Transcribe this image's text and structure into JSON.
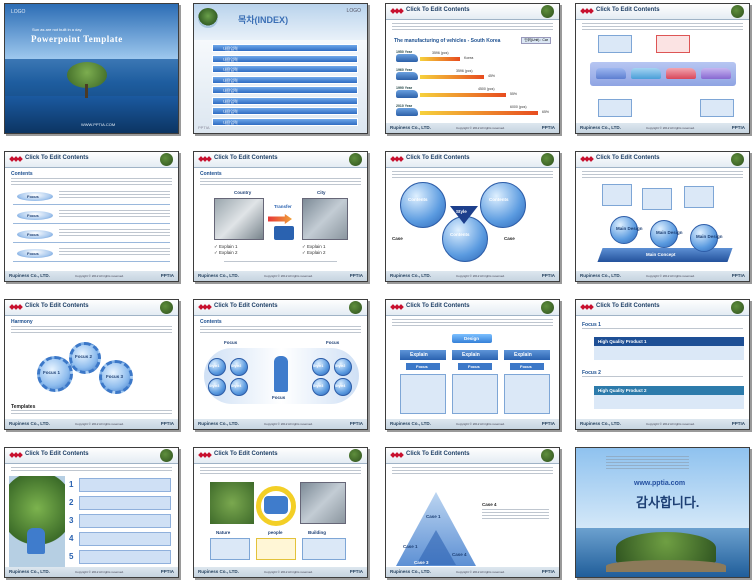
{
  "common": {
    "header_title": "Click To Edit Contents",
    "company": "Rupiness Co., LTD.",
    "copyright": "Copyright © 2012 All rights reserved.",
    "footer_brand": "PPTIA",
    "contents": "Contents"
  },
  "s1": {
    "logo": "LOGO",
    "tagline": "Sun as are not built in a day",
    "title": "Powerpoint Template",
    "url": "WWW.PPTIA.COM"
  },
  "s2": {
    "title": "목차(INDEX)",
    "logo": "LOGO",
    "items": [
      "내용입력",
      "내용입력",
      "내용입력",
      "내용입력",
      "내용입력",
      "내용입력",
      "내용입력",
      "내용입력"
    ]
  },
  "s3": {
    "chart_title": "The manufacturing of vehicles - South Korea",
    "badge": "단위(Unit) : Car",
    "rows": [
      {
        "year": "1950 Year",
        "value": "3596 (pcs)",
        "pct": "Korea"
      },
      {
        "year": "1960 Year",
        "value": "3596 (pcs)",
        "pct": "45%"
      },
      {
        "year": "1990 Year",
        "value": "4500 (pcs)",
        "pct": "55%"
      },
      {
        "year": "2010 Year",
        "value": "6000 (pcs)",
        "pct": "65%"
      }
    ]
  },
  "s5": {
    "focus": [
      "Focus",
      "Focus",
      "Focus",
      "Focus"
    ]
  },
  "s6": {
    "country": "Country",
    "transfer": "Transfer",
    "city": "City",
    "ex1": "✓ Explain 1",
    "ex2": "✓ Explain 2",
    "ex1b": "✓ Explain 1",
    "ex2b": "✓ Explain 2"
  },
  "s7": {
    "contents": [
      "Contents",
      "Contents",
      "Contents"
    ],
    "style": "Style",
    "case_l": "Case",
    "case_r": "Case"
  },
  "s8": {
    "main": [
      "Main Design",
      "Main Design",
      "Main Design"
    ],
    "concept": "Main Concept"
  },
  "s9": {
    "harmony": "Harmony",
    "focus": [
      "Focus 1",
      "Focus 2",
      "Focus 3"
    ],
    "templates": "Templates"
  },
  "s10": {
    "focus_l": "Focus",
    "focus_r": "Focus",
    "styles": [
      "Style1",
      "Style2",
      "Style3",
      "Style4"
    ],
    "styles_r": [
      "Style1",
      "Style2",
      "Style3",
      "Style4"
    ],
    "center": "Focus"
  },
  "s11": {
    "design": "Design",
    "explain": [
      "Explain",
      "Explain",
      "Explain"
    ],
    "focus": [
      "Focus",
      "Focus",
      "Focus"
    ]
  },
  "s12": {
    "focus1": "Focus 1",
    "hq1": "High Quality Product 1",
    "focus2": "Focus 2",
    "hq2": "High Quality Product 2"
  },
  "s13": {
    "nums": [
      "1",
      "2",
      "3",
      "4",
      "5"
    ]
  },
  "s14": {
    "nature": "Nature",
    "people": "people",
    "building": "Building"
  },
  "s15": {
    "case1": "Case 1",
    "case2": "Case 1",
    "case3": "Case 3",
    "case4": "Case 4",
    "case_r": "Case 4"
  },
  "s16": {
    "url": "www.pptia.com",
    "thanks": "감사합니다."
  }
}
